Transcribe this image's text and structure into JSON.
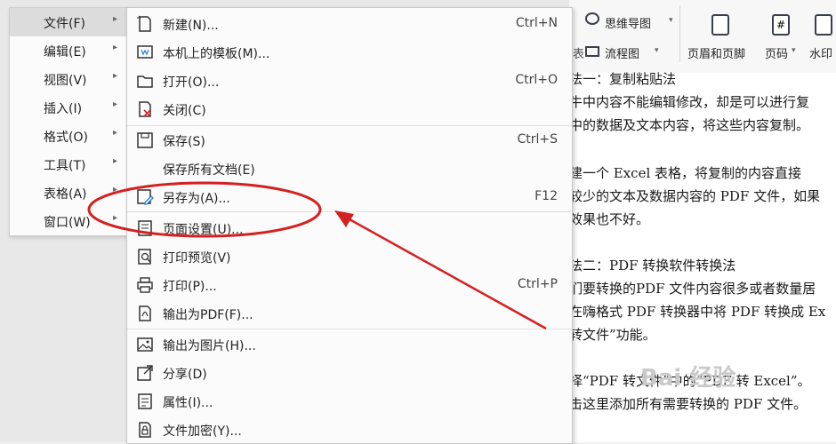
{
  "ribbon": {
    "mindmap": "思维导图",
    "flowchart": "流程图",
    "header_footer": "页眉和页脚",
    "page_number": "页码",
    "watermark": "水印",
    "left_fragment": "表"
  },
  "document": {
    "lines": [
      "法一：复制粘贴法",
      "牛中内容不能编辑修改，却是可以进行复",
      "中的数据及文本内容，将这些内容复制。",
      "建一个 Excel 表格，将复制的内容直接",
      "较少的文本及数据内容的 PDF 文件，如果",
      "效果也不好。",
      "法二：PDF 转换软件转换法",
      "们要转换的PDF 文件内容很多或者数量居",
      "在嗨格式 PDF 转换器中将 PDF 转换成 Ex",
      "转文件”功能。",
      "择“PDF 转文件”中的“PDF 转 Excel”。",
      "击这里添加所有需要转换的 PDF 文件。"
    ],
    "watermark_text": "Bai 经验"
  },
  "main_menu": {
    "items": [
      {
        "label": "文件(F)"
      },
      {
        "label": "编辑(E)"
      },
      {
        "label": "视图(V)"
      },
      {
        "label": "插入(I)"
      },
      {
        "label": "格式(O)"
      },
      {
        "label": "工具(T)"
      },
      {
        "label": "表格(A)"
      },
      {
        "label": "窗口(W)"
      }
    ]
  },
  "file_menu": {
    "items": [
      {
        "label": "新建(N)...",
        "shortcut": "Ctrl+N",
        "icon": "new-doc-icon"
      },
      {
        "label": "本机上的模板(M)...",
        "shortcut": "",
        "icon": "template-icon"
      },
      {
        "label": "打开(O)...",
        "shortcut": "Ctrl+O",
        "icon": "folder-icon"
      },
      {
        "label": "关闭(C)",
        "shortcut": "",
        "icon": "close-doc-icon"
      },
      {
        "label": "保存(S)",
        "shortcut": "Ctrl+S",
        "icon": "save-icon"
      },
      {
        "label": "保存所有文档(E)",
        "shortcut": "",
        "icon": ""
      },
      {
        "label": "另存为(A)...",
        "shortcut": "F12",
        "icon": "save-as-icon"
      },
      {
        "label": "页面设置(U)...",
        "shortcut": "",
        "icon": "page-setup-icon"
      },
      {
        "label": "打印预览(V)",
        "shortcut": "",
        "icon": "print-preview-icon"
      },
      {
        "label": "打印(P)...",
        "shortcut": "Ctrl+P",
        "icon": "printer-icon"
      },
      {
        "label": "输出为PDF(F)...",
        "shortcut": "",
        "icon": "pdf-export-icon"
      },
      {
        "label": "输出为图片(H)...",
        "shortcut": "",
        "icon": "image-export-icon"
      },
      {
        "label": "分享(D)",
        "shortcut": "",
        "icon": "share-icon"
      },
      {
        "label": "属性(I)...",
        "shortcut": "",
        "icon": "properties-icon"
      },
      {
        "label": "文件加密(Y)...",
        "shortcut": "",
        "icon": "encrypt-icon"
      }
    ]
  },
  "colors": {
    "annotation_red": "#d42020",
    "submenu_arrow": "#666666"
  }
}
